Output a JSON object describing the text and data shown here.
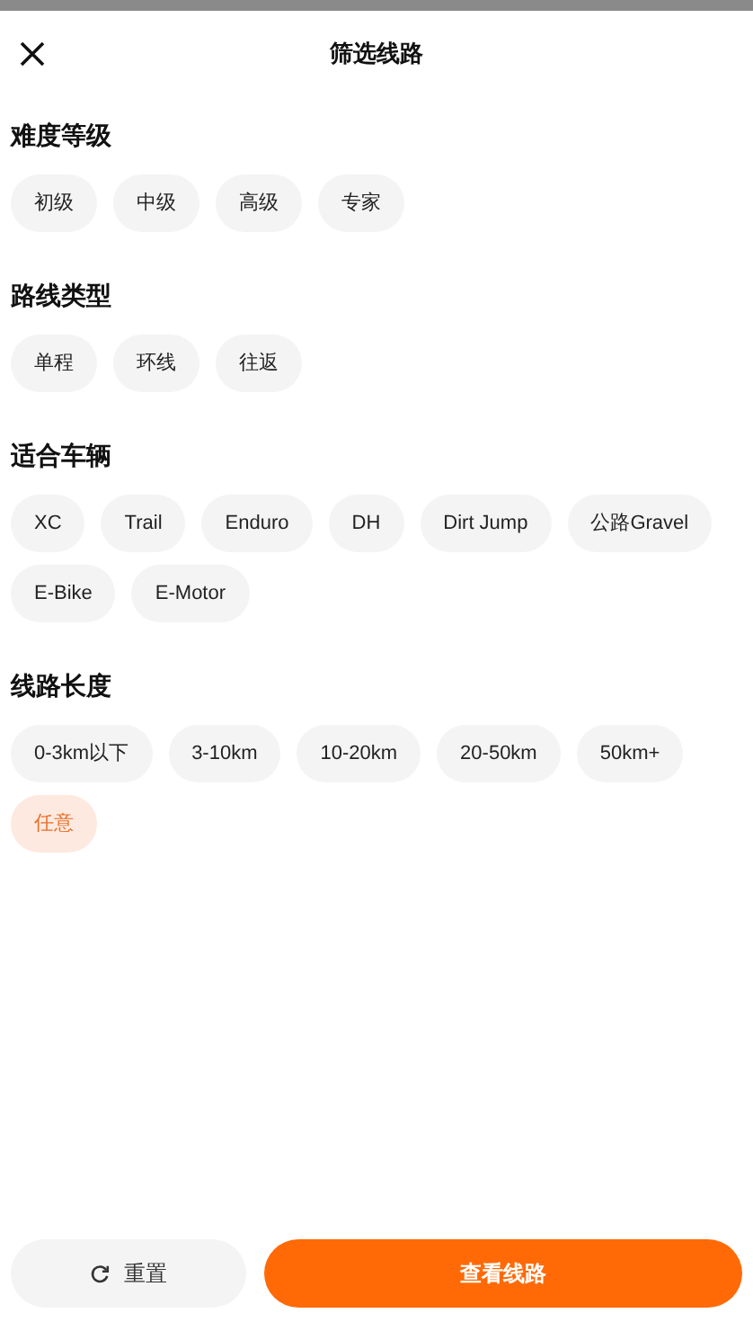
{
  "header": {
    "title": "筛选线路"
  },
  "sections": [
    {
      "title": "难度等级",
      "options": [
        {
          "label": "初级",
          "selected": false
        },
        {
          "label": "中级",
          "selected": false
        },
        {
          "label": "高级",
          "selected": false
        },
        {
          "label": "专家",
          "selected": false
        }
      ]
    },
    {
      "title": "路线类型",
      "options": [
        {
          "label": "单程",
          "selected": false
        },
        {
          "label": "环线",
          "selected": false
        },
        {
          "label": "往返",
          "selected": false
        }
      ]
    },
    {
      "title": "适合车辆",
      "options": [
        {
          "label": "XC",
          "selected": false
        },
        {
          "label": "Trail",
          "selected": false
        },
        {
          "label": "Enduro",
          "selected": false
        },
        {
          "label": "DH",
          "selected": false
        },
        {
          "label": "Dirt Jump",
          "selected": false
        },
        {
          "label": "公路Gravel",
          "selected": false
        },
        {
          "label": "E-Bike",
          "selected": false
        },
        {
          "label": "E-Motor",
          "selected": false
        }
      ]
    },
    {
      "title": "线路长度",
      "options": [
        {
          "label": "0-3km以下",
          "selected": false
        },
        {
          "label": "3-10km",
          "selected": false
        },
        {
          "label": "10-20km",
          "selected": false
        },
        {
          "label": "20-50km",
          "selected": false
        },
        {
          "label": "50km+",
          "selected": false
        },
        {
          "label": "任意",
          "selected": true
        }
      ]
    }
  ],
  "footer": {
    "reset": "重置",
    "submit": "查看线路"
  }
}
